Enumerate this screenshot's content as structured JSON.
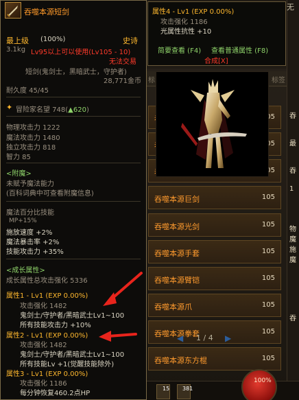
{
  "background": {
    "tab_left": "标",
    "tab_right": "标签",
    "right_top_text": "无",
    "list": [
      {
        "name": "吞噬本源",
        "level": "105"
      },
      {
        "name": "吞噬本源",
        "level": "105"
      },
      {
        "name": "吞噬本源",
        "level": "105"
      },
      {
        "name": "吞噬本源巨剑",
        "level": "105"
      },
      {
        "name": "吞噬本源光剑",
        "level": "105"
      },
      {
        "name": "吞噬本源手套",
        "level": "105"
      },
      {
        "name": "吞噬本源臂铠",
        "level": "105"
      },
      {
        "name": "吞噬本源爪",
        "level": "105"
      },
      {
        "name": "吞噬本源拳套",
        "level": "105"
      },
      {
        "name": "吞噬本源东方棍",
        "level": "105"
      }
    ],
    "right_edge_letters": [
      "吞",
      "最",
      "吞",
      "1",
      "物",
      "魔",
      "施",
      "魔",
      "吞"
    ],
    "pager": {
      "prev": "◀",
      "pages": "1 / 4",
      "next": "▶"
    },
    "hp_orb": "100%",
    "slot_numbers": [
      "15",
      "381"
    ]
  },
  "tooltip2": {
    "attr_title": "属性4 - Lv1 (EXP 0.00%)",
    "attack_boost": "攻击强化 1186",
    "light_res": "光属性抗性 +10",
    "link_f4": "简要查看 (F4)",
    "link_f8": "查看普通属性 (F8)",
    "synthesis": "合成[X]"
  },
  "tooltip": {
    "item_name": "吞噬本源短剑",
    "rarity_left": "最上级",
    "rarity_pct": "(100%)",
    "rarity_right": "史诗",
    "weight": "3.1kg",
    "level_req": "Lv95以上可以使用(Lv105 - 10)",
    "untradeable": "无法交易",
    "job_line": "短剑(鬼剑士，黑暗武士，守护者)",
    "price": "28,771金币",
    "durability": "耐久度 45/45",
    "fame": "冒险家名望 748(",
    "fame_up": "▲620",
    "fame_close": ")",
    "stats": [
      "物理攻击力 1222",
      "魔法攻击力 1480",
      "独立攻击力 818",
      "智力 85"
    ],
    "enchant_header": "<附魔>",
    "enchant_none": "未赋予魔法能力",
    "enchant_hint": "(百科词典中可查看附魔信息)",
    "magic_pct": "魔法百分比技能",
    "mp": "MP+15%",
    "cast_speed": "施放速度 +2%",
    "magic_crit": "魔法暴击率 +2%",
    "attack_power": "技能攻击力 +35%",
    "growth_header": "<成长属性>",
    "growth_total": "成长属性总攻击强化 5336",
    "attr1_title": "属性1 - Lv1 (EXP 0.00%)",
    "attr1_boost": "攻击强化 1482",
    "attr1_skill": "鬼剑士/守护者/黑暗武士Lv1~100",
    "attr1_bonus": "所有技能攻击力 +10%",
    "attr2_title": "属性2 - Lv1 (EXP 0.00%)",
    "attr2_boost": "攻击强化 1482",
    "attr2_skill": "鬼剑士/守护者/黑暗武士Lv1~100",
    "attr2_bonus": "所有技能Lv +1(觉醒技能除外)",
    "attr3_title": "属性3 - Lv1 (EXP 0.00%)",
    "attr3_boost": "攻击强化 1186",
    "attr3_hp": "每分钟恢复460.2点HP"
  },
  "colors": {
    "legendary_name": "#ff9a2a",
    "untradeable": "#ff3a2a",
    "annotation_arrow": "#e8241c"
  }
}
